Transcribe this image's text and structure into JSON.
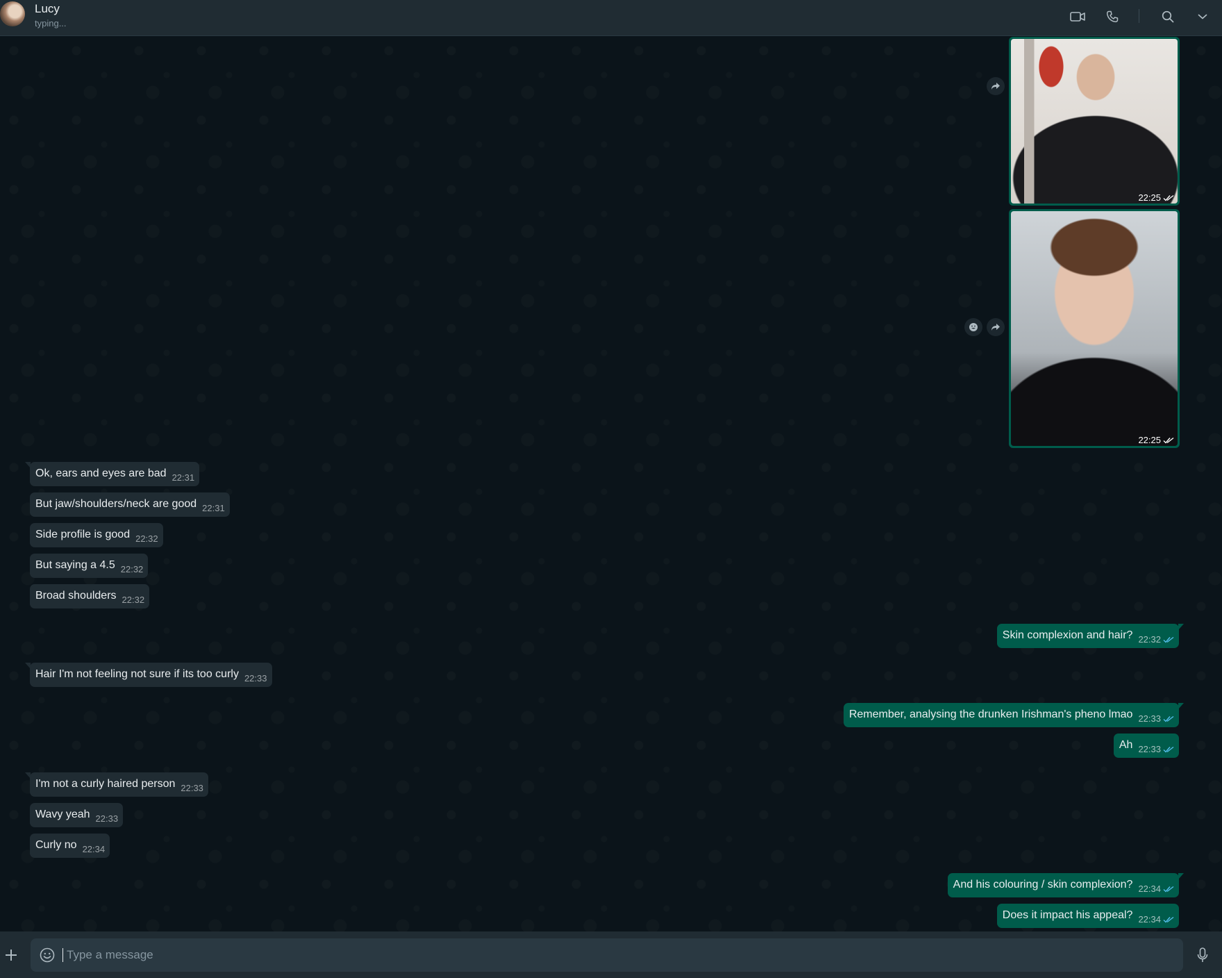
{
  "header": {
    "contact_name": "Lucy",
    "status": "typing...",
    "icons": [
      "video-call-icon",
      "voice-call-icon",
      "search-icon",
      "chevron-down-icon"
    ]
  },
  "media_messages": [
    {
      "time": "22:25",
      "status": "read",
      "description": "photo"
    },
    {
      "time": "22:25",
      "status": "read",
      "description": "photo"
    }
  ],
  "messages": [
    {
      "dir": "in",
      "text": "Ok, ears and eyes are bad",
      "time": "22:31"
    },
    {
      "dir": "in",
      "text": "But jaw/shoulders/neck are good",
      "time": "22:31"
    },
    {
      "dir": "in",
      "text": "Side profile is good",
      "time": "22:32"
    },
    {
      "dir": "in",
      "text": "But saying a 4.5",
      "time": "22:32"
    },
    {
      "dir": "in",
      "text": "Broad shoulders",
      "time": "22:32"
    },
    {
      "dir": "out",
      "text": "Skin complexion and hair?",
      "time": "22:32"
    },
    {
      "dir": "in",
      "text": "Hair I'm not feeling not sure if its too curly",
      "time": "22:33"
    },
    {
      "dir": "out",
      "text": "Remember, analysing the drunken Irishman's pheno lmao",
      "time": "22:33"
    },
    {
      "dir": "out",
      "text": "Ah",
      "time": "22:33"
    },
    {
      "dir": "in",
      "text": "I'm not a curly haired person",
      "time": "22:33"
    },
    {
      "dir": "in",
      "text": "Wavy yeah",
      "time": "22:33"
    },
    {
      "dir": "in",
      "text": "Curly no",
      "time": "22:34"
    },
    {
      "dir": "out",
      "text": "And his colouring / skin complexion?",
      "time": "22:34"
    },
    {
      "dir": "out",
      "text": "Does it impact his appeal?",
      "time": "22:34"
    }
  ],
  "composer": {
    "placeholder": "Type a message"
  },
  "colors": {
    "header_bg": "#202c33",
    "chat_bg": "#0b141a",
    "incoming_bubble": "#202c33",
    "outgoing_bubble": "#005c4b",
    "read_ticks": "#53bdeb"
  }
}
